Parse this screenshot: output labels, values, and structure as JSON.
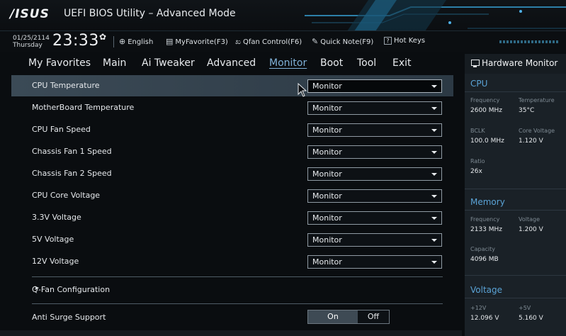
{
  "titlebar": {
    "logo": "/ISUS",
    "title": "UEFI BIOS Utility – Advanced Mode"
  },
  "infobar": {
    "date": "01/25/2114",
    "day": "Thursday",
    "time": "23:33",
    "language": "English",
    "myfavorite": "MyFavorite(F3)",
    "qfan": "Qfan Control(F6)",
    "quicknote": "Quick Note(F9)",
    "hotkeys": "Hot Keys",
    "hotkeys_key": "?"
  },
  "menu": {
    "items": [
      "My Favorites",
      "Main",
      "Ai Tweaker",
      "Advanced",
      "Monitor",
      "Boot",
      "Tool",
      "Exit"
    ],
    "active": "Monitor"
  },
  "main": {
    "rows": [
      {
        "label": "CPU Temperature",
        "value": "Monitor"
      },
      {
        "label": "MotherBoard Temperature",
        "value": "Monitor"
      },
      {
        "label": "CPU Fan Speed",
        "value": "Monitor"
      },
      {
        "label": "Chassis Fan 1 Speed",
        "value": "Monitor"
      },
      {
        "label": "Chassis Fan 2 Speed",
        "value": "Monitor"
      },
      {
        "label": "CPU Core Voltage",
        "value": "Monitor"
      },
      {
        "label": "3.3V Voltage",
        "value": "Monitor"
      },
      {
        "label": "5V Voltage",
        "value": "Monitor"
      },
      {
        "label": "12V Voltage",
        "value": "Monitor"
      }
    ],
    "qfan_config": "Q-Fan Configuration",
    "anti_surge": {
      "label": "Anti Surge Support",
      "on": "On",
      "off": "Off",
      "selected": "On"
    }
  },
  "hwmon": {
    "title": "Hardware Monitor",
    "cpu": {
      "title": "CPU",
      "frequency_label": "Frequency",
      "frequency": "2600 MHz",
      "temperature_label": "Temperature",
      "temperature": "35°C",
      "bclk_label": "BCLK",
      "bclk": "100.0 MHz",
      "core_voltage_label": "Core Voltage",
      "core_voltage": "1.120 V",
      "ratio_label": "Ratio",
      "ratio": "26x"
    },
    "memory": {
      "title": "Memory",
      "frequency_label": "Frequency",
      "frequency": "2133 MHz",
      "voltage_label": "Voltage",
      "voltage": "1.200 V",
      "capacity_label": "Capacity",
      "capacity": "4096 MB"
    },
    "voltage": {
      "title": "Voltage",
      "v12_label": "+12V",
      "v12": "12.096 V",
      "v5_label": "+5V",
      "v5": "5.160 V"
    }
  },
  "colors": {
    "accent": "#5aa3d6",
    "active_tab": "#7fb0d6",
    "selected_row": "#3b4a56",
    "panel": "#1a2127"
  }
}
